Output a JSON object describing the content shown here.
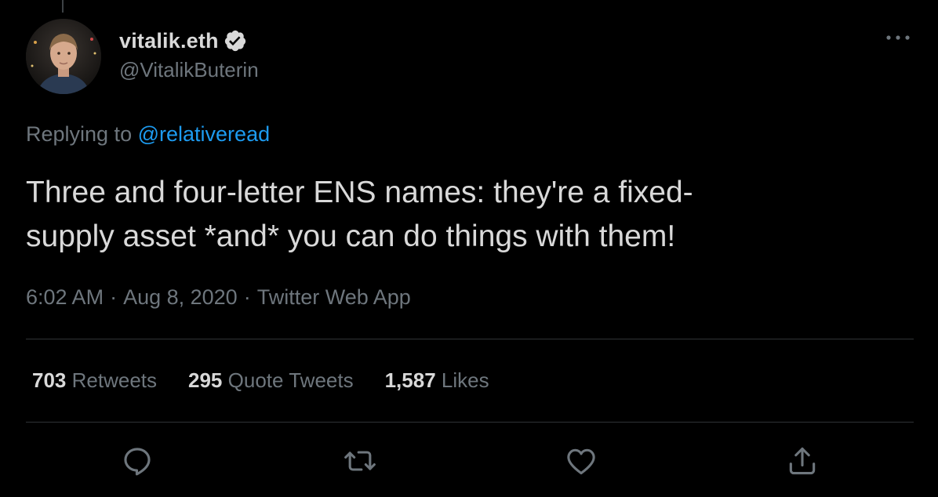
{
  "user": {
    "display_name": "vitalik.eth",
    "handle": "@VitalikButerin",
    "verified_icon": "verified-badge-icon"
  },
  "reply": {
    "prefix": "Replying to",
    "mention": "@relativeread"
  },
  "tweet": {
    "text": "Three and four-letter ENS names: they're a fixed-\nsupply asset *and* you can do things with them!"
  },
  "meta": {
    "time": "6:02 AM",
    "separator": "·",
    "date": "Aug 8, 2020",
    "source": "Twitter Web App"
  },
  "stats": {
    "retweets_count": "703",
    "retweets_label": "Retweets",
    "quotes_count": "295",
    "quotes_label": "Quote Tweets",
    "likes_count": "1,587",
    "likes_label": "Likes"
  },
  "actions": [
    "reply-icon",
    "retweet-icon",
    "like-icon",
    "share-icon"
  ],
  "colors": {
    "background": "#000000",
    "text": "#d9d9d9",
    "muted": "#6e767d",
    "accent": "#1d9bf0",
    "divider": "#2f3336"
  }
}
